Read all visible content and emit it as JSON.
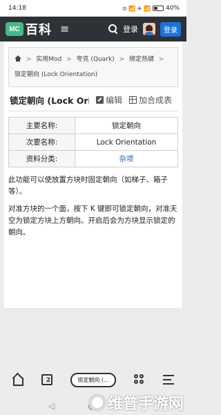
{
  "status_bar": {
    "time": "14:18",
    "icons": "⊙ 📶 ✈ 📶",
    "battery": "40%",
    "battery_level": 0.4
  },
  "header": {
    "logo_badge": "MC",
    "logo_text": "百科",
    "menu_glyph": "≡",
    "login_label": "登录",
    "register_label": "登录"
  },
  "breadcrumb": {
    "items": [
      "实用Mod",
      "夸克 (Quark)",
      "绑定热键",
      "锁定朝向 (Lock Orientation)"
    ],
    "separator": ">"
  },
  "title": {
    "text": "锁定朝向 (Lock Orientation)",
    "edit_label": "编辑",
    "add_label": "加合成表"
  },
  "info_table": [
    {
      "key": "主要名称:",
      "value": "锁定朝向"
    },
    {
      "key": "次要名称:",
      "value": "Lock Orientation"
    },
    {
      "key": "资料分类:",
      "value": "杂项"
    }
  ],
  "paragraphs": [
    "此功能可以使放置方块时固定朝向（如梯子、箱子等）。",
    "对准方块的一个面，按下 K 键即可锁定朝向，对准天空为锁定方块上方朝向。开启后会为方块显示锁定的朝向。"
  ],
  "bottom_bar": {
    "tabs_count": "2",
    "current_page": "锁定朝向 (..."
  },
  "watermark": "维普手游网",
  "colors": {
    "header_bg": "#2e3236",
    "logo_green": "#44b98a",
    "register_blue": "#1a73d9",
    "link_blue": "#1a5fb4"
  }
}
